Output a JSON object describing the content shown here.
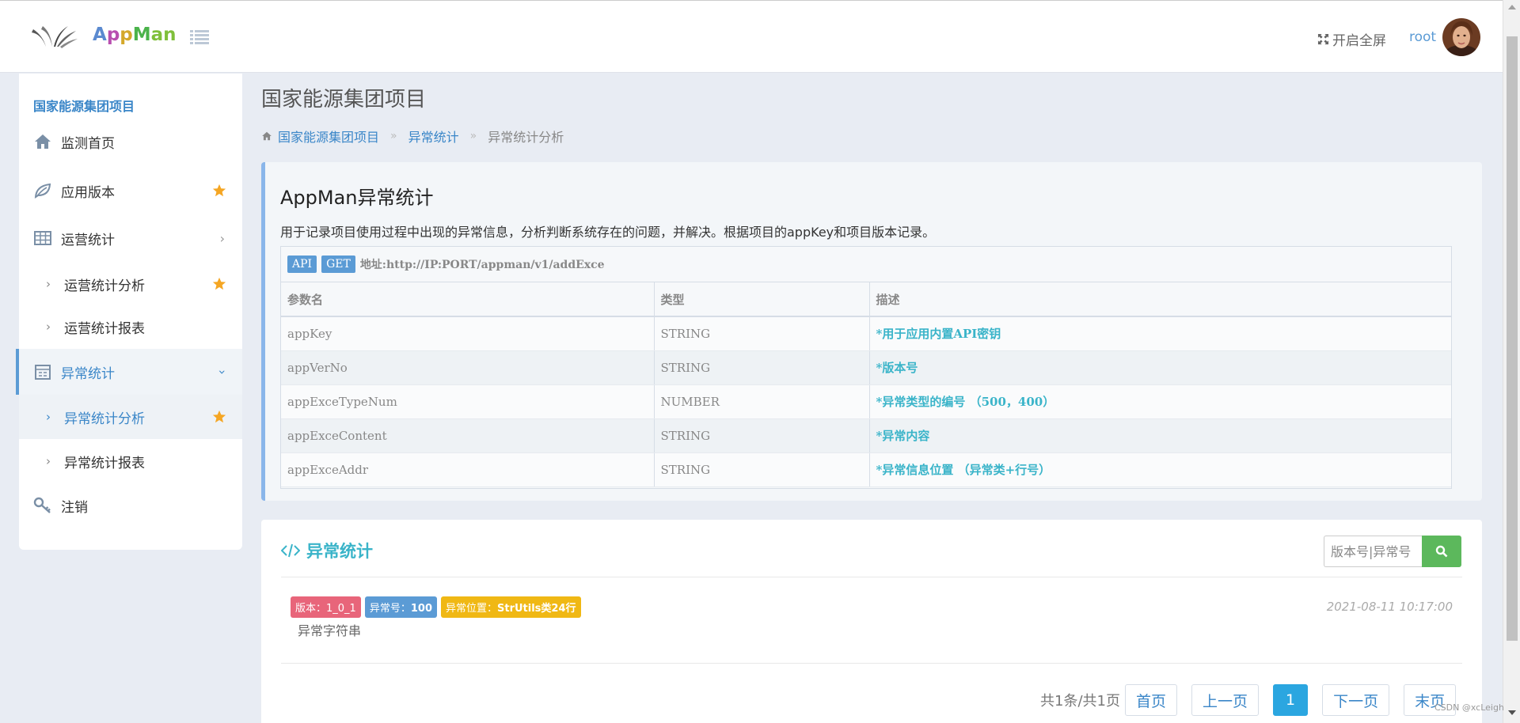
{
  "header": {
    "logo_text": [
      "A",
      "p",
      "p",
      "M",
      "an"
    ],
    "fullscreen_label": "开启全屏",
    "username": "root"
  },
  "sidebar": {
    "project": "国家能源集团项目",
    "items": [
      {
        "label": "监测首页",
        "icon": "home-icon"
      },
      {
        "label": "应用版本",
        "icon": "leaf-icon",
        "starred": true
      },
      {
        "label": "运营统计",
        "icon": "table-icon",
        "expanded": false
      },
      {
        "label": "运营统计分析",
        "sub": true,
        "starred": true
      },
      {
        "label": "运营统计报表",
        "sub": true
      },
      {
        "label": "异常统计",
        "icon": "calendar-icon",
        "expanded": true,
        "active": true
      },
      {
        "label": "异常统计分析",
        "sub": true,
        "starred": true,
        "active": true
      },
      {
        "label": "异常统计报表",
        "sub": true
      },
      {
        "label": "注销",
        "icon": "key-icon"
      }
    ]
  },
  "main": {
    "page_title": "国家能源集团项目",
    "breadcrumb": [
      "国家能源集团项目",
      "异常统计",
      "异常统计分析"
    ],
    "breadcrumb_sep": "»",
    "info": {
      "title": "AppMan异常统计",
      "description": "用于记录项目使用过程中出现的异常信息，分析判断系统存在的问题，并解决。根据项目的appKey和项目版本记录。",
      "tags": [
        "API",
        "GET"
      ],
      "url": "地址:http://IP:PORT/appman/v1/addExce",
      "columns": [
        "参数名",
        "类型",
        "描述"
      ],
      "rows": [
        [
          "appKey",
          "STRING",
          "*用于应用内置API密钥"
        ],
        [
          "appVerNo",
          "STRING",
          "*版本号"
        ],
        [
          "appExceTypeNum",
          "NUMBER",
          "*异常类型的编号 （500，400）"
        ],
        [
          "appExceContent",
          "STRING",
          "*异常内容"
        ],
        [
          "appExceAddr",
          "STRING",
          "*异常信息位置 （异常类+行号）"
        ]
      ]
    },
    "list": {
      "title": "异常统计",
      "search_placeholder": "版本号|异常号",
      "record": {
        "version_label": "版本：",
        "version": "1_0_1",
        "code_label": "异常号：",
        "code": "100",
        "location_label": "异常位置：",
        "location": "StrUtils类24行",
        "time": "2021-08-11 10:17:00",
        "content": "异常字符串"
      },
      "pager": {
        "info": "共1条/共1页",
        "first": "首页",
        "prev": "上一页",
        "current": "1",
        "next": "下一页",
        "last": "末页"
      }
    },
    "watermark": "CSDN @xcLeigh"
  },
  "colors": {
    "accent": "#3a86c8",
    "teal": "#3ab4c9",
    "badge_red": "#e8657a",
    "badge_blue": "#5b9bd5",
    "badge_yellow": "#f0b814",
    "search_green": "#5cb85c",
    "pager_active": "#2ba6e0"
  }
}
